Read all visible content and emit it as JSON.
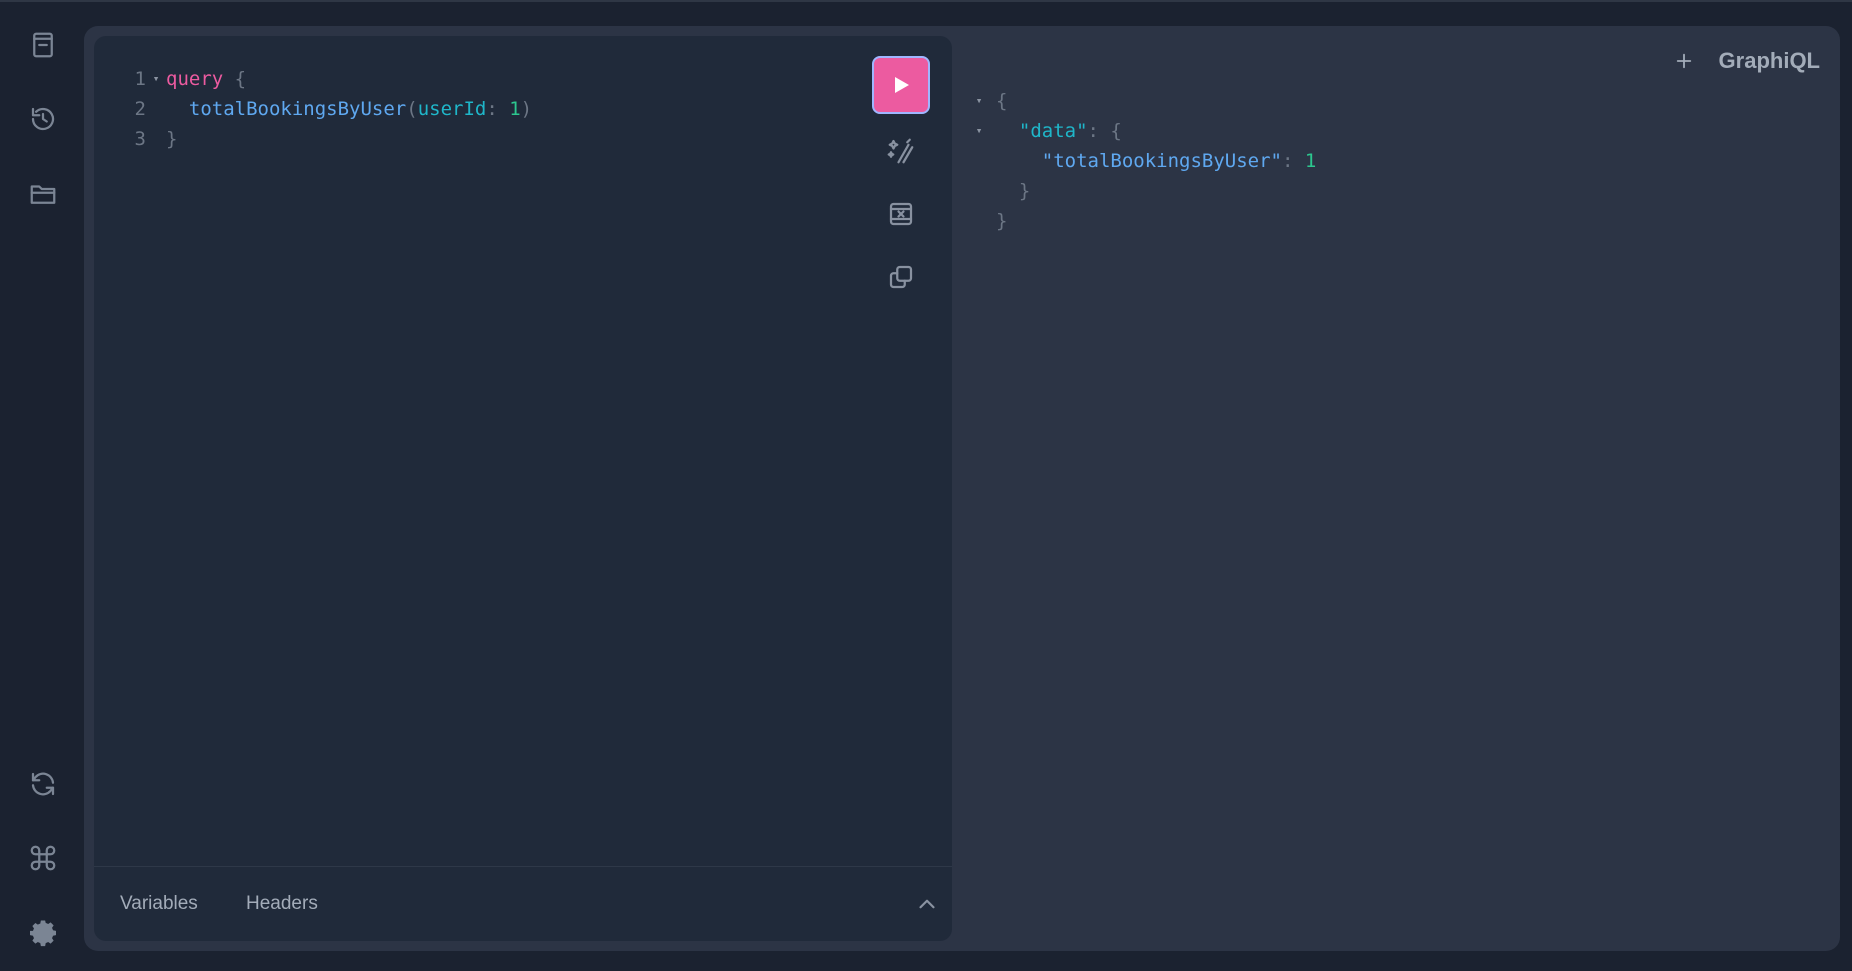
{
  "app": {
    "logo": "GraphiQL"
  },
  "sidebar": {
    "top_icons": [
      "docs-icon",
      "history-icon",
      "explorer-icon"
    ],
    "bottom_icons": [
      "refresh-icon",
      "command-icon",
      "settings-icon"
    ]
  },
  "editor": {
    "lines": [
      {
        "num": "1",
        "keyword": "query",
        "open": " {"
      },
      {
        "num": "2",
        "indent": "  ",
        "field": "totalBookingsByUser",
        "paren_open": "(",
        "arg": "userId",
        "colon": ": ",
        "value": "1",
        "paren_close": ")"
      },
      {
        "num": "3",
        "close": "}"
      }
    ]
  },
  "toolbar": {
    "run_label": "Execute query",
    "tools": [
      "prettify-icon",
      "merge-icon",
      "copy-icon"
    ]
  },
  "bottom": {
    "tabs": [
      "Variables",
      "Headers"
    ]
  },
  "result": {
    "open_brace": "{",
    "data_key": "\"data\"",
    "data_sep": ": {",
    "field_key": "\"totalBookingsByUser\"",
    "field_sep": ": ",
    "field_value": "1",
    "inner_close": "}",
    "outer_close": "}"
  },
  "colors": {
    "accent": "#ec5ba0",
    "keyword": "#ec5ba0",
    "field": "#5fa8f0",
    "argument": "#1fb6c9",
    "number": "#2cc78f"
  }
}
